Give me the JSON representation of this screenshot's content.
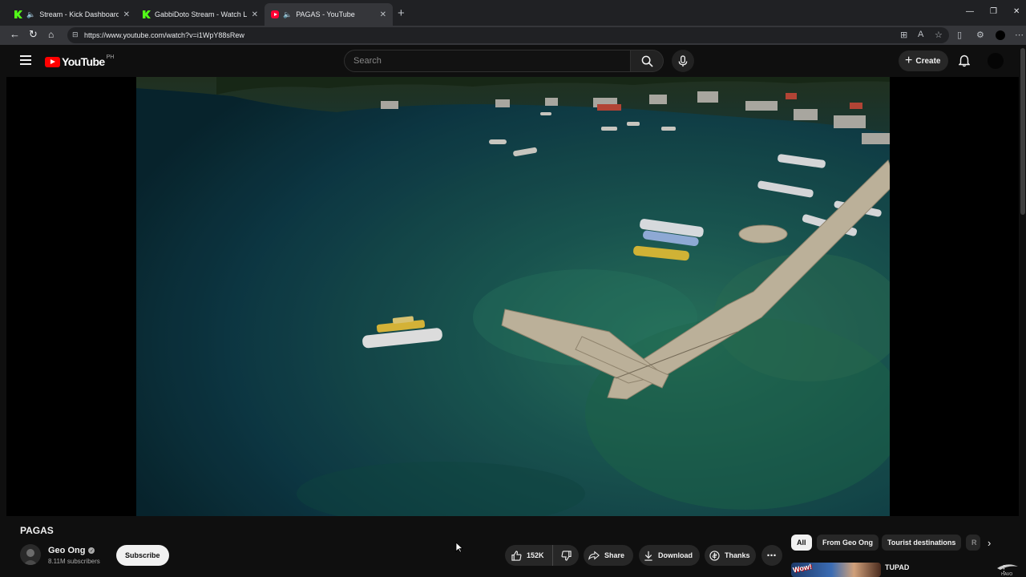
{
  "browser": {
    "tabs": [
      {
        "title": "Stream - Kick Dashboard",
        "icon": "kick-icon",
        "audio": true,
        "active": false
      },
      {
        "title": "GabbiDoto Stream - Watch Live o",
        "icon": "kick-icon",
        "audio": false,
        "active": false
      },
      {
        "title": "PAGAS - YouTube",
        "icon": "youtube-icon",
        "audio": true,
        "active": true
      }
    ],
    "url": "https://www.youtube.com/watch?v=i1WpY88sRew"
  },
  "youtube": {
    "logo_text": "YouTube",
    "country_code": "PH",
    "search_placeholder": "Search",
    "create_label": "Create"
  },
  "video": {
    "title": "PAGAS",
    "channel": {
      "name": "Geo Ong",
      "subscribers": "8.11M subscribers",
      "verified": true
    },
    "subscribe_label": "Subscribe",
    "likes": "152K",
    "actions": {
      "share": "Share",
      "download": "Download",
      "thanks": "Thanks"
    }
  },
  "recommendations": {
    "chips": [
      "All",
      "From Geo Ong",
      "Tourist destinations",
      "R"
    ],
    "selected_chip": "All",
    "first_item": {
      "title": "TUPAD",
      "thumb_text": "Wow!"
    }
  },
  "colors": {
    "youtube_red": "#ff0000",
    "kick_green": "#53fc18",
    "background": "#0f0f0f"
  }
}
